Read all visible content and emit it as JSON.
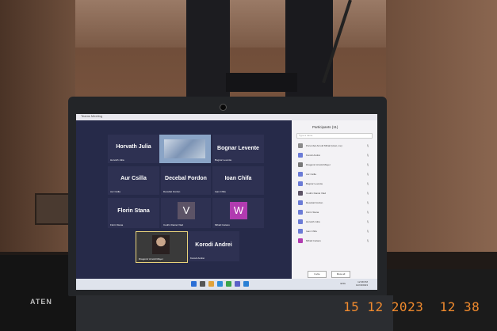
{
  "meeting": {
    "window_title": "Teams Meeting",
    "tiles": [
      {
        "name": "Horvath Julia",
        "label": "Horvath Julia"
      },
      {
        "name": "",
        "label": ""
      },
      {
        "name": "Bognar Levente",
        "label": "Bognar Levente"
      },
      {
        "name": "Aur Csilla",
        "label": "Aur Csilla"
      },
      {
        "name": "Decebal Fordon",
        "label": "Decebal Fordon"
      },
      {
        "name": "Ioan Chifa",
        "label": "Ioan Chifa"
      },
      {
        "name": "Florin Stana",
        "label": "Florin Stana"
      },
      {
        "name": "V",
        "label": "Codrin Daniel Vlad"
      },
      {
        "name": "W",
        "label": "Mihail Cazacu"
      },
      {
        "name": "",
        "label": "Dragomir Arnold Mayer"
      },
      {
        "name": "Korodi Andrei",
        "label": "Korodi Andrei"
      }
    ],
    "colors": {
      "screen_bg": "#262a49",
      "tile_bg": "#2e3152",
      "avatar_v": "#5c5366",
      "avatar_w": "#b13bb0"
    }
  },
  "participants_panel": {
    "title": "Participants (11)",
    "search_placeholder": "Type a name",
    "items": [
      {
        "name": "Porumbel Arnold Mihail (Host, me)",
        "color": "#8a8a8a"
      },
      {
        "name": "Korodi Andrei",
        "color": "#6b7bd6"
      },
      {
        "name": "Dragomir Arnold Mayer",
        "color": "#777777"
      },
      {
        "name": "Aur Csilla",
        "color": "#6b7bd6"
      },
      {
        "name": "Bognar Levente",
        "color": "#6b7bd6"
      },
      {
        "name": "Codrin Daniel Vlad",
        "color": "#5c5366"
      },
      {
        "name": "Decebal Fordon",
        "color": "#6b7bd6"
      },
      {
        "name": "Florin Stana",
        "color": "#6b7bd6"
      },
      {
        "name": "Horvath Julia",
        "color": "#6b7bd6"
      },
      {
        "name": "Ioan Chifa",
        "color": "#6b7bd6"
      },
      {
        "name": "Mihail Cazacu",
        "color": "#b13bb0"
      }
    ],
    "invite_label": "Invite",
    "mute_label": "Mute all"
  },
  "taskbar": {
    "time": "12:38 PM",
    "date": "12/15/2023",
    "tray": "ENG"
  },
  "photo": {
    "timestamp": "15 12 2023  12 38",
    "device_label": "ATEN"
  }
}
